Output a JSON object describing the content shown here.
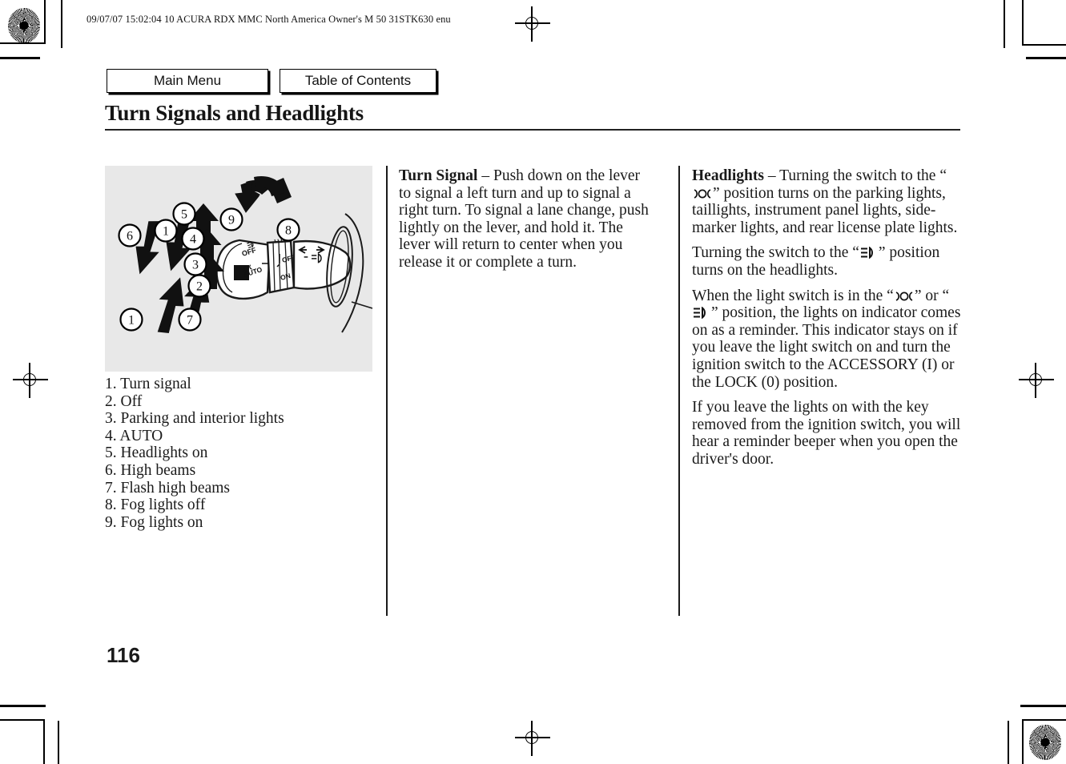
{
  "print_header": "09/07/07 15:02:04    10 ACURA RDX MMC North America Owner's M 50 31STK630 enu",
  "nav": {
    "main_menu": "Main Menu",
    "table_of_contents": "Table of Contents"
  },
  "page_title": "Turn Signals and Headlights",
  "page_number": "116",
  "figure": {
    "alt": "Steering column light stalk with callout numbers 1-9",
    "callouts": [
      "1",
      "1",
      "2",
      "3",
      "4",
      "5",
      "6",
      "7",
      "8",
      "9"
    ],
    "switch_labels": [
      "OFF",
      "AUTO",
      "OFF",
      "ON"
    ],
    "background_color": "#e8e8e8"
  },
  "legend": [
    "1. Turn signal",
    "2. Off",
    "3. Parking and interior lights",
    "4. AUTO",
    "5. Headlights on",
    "6. High beams",
    "7. Flash high beams",
    "8. Fog lights off",
    "9. Fog lights on"
  ],
  "middle_column": {
    "heading": "Turn Signal",
    "dash": "–",
    "paragraph": "Push down on the lever to signal a left turn and up to signal a right turn. To signal a lane change, push lightly on the lever, and hold it. The lever will return to center when you release it or complete a turn."
  },
  "right_column": {
    "heading": "Headlights",
    "dash": "–",
    "p1_a": "Turning the switch to the “",
    "p1_b": "” position turns on the parking lights, taillights, instrument panel lights, side-marker lights, and rear license plate lights.",
    "p2_a": "Turning the switch to the “",
    "p2_b": "” position turns on the headlights.",
    "p3_a": "When the light switch is in the “",
    "p3_b": "” or “",
    "p3_c": "” position, the lights on indicator comes on as a reminder. This indicator stays on if you leave the light switch on and turn the ignition switch to the ACCESSORY (I) or the LOCK (0) position.",
    "p4": "If you leave the lights on with the key removed from the ignition switch, you will hear a reminder beeper when you open the driver's door."
  },
  "symbols": {
    "parking_lights": "parking-lights-symbol",
    "headlights": "headlights-symbol",
    "fog_lights": "fog-lights-symbol"
  },
  "colors": {
    "ink": "#1a1a1a",
    "figure_bg": "#e8e8e8",
    "rule": "#222222"
  }
}
